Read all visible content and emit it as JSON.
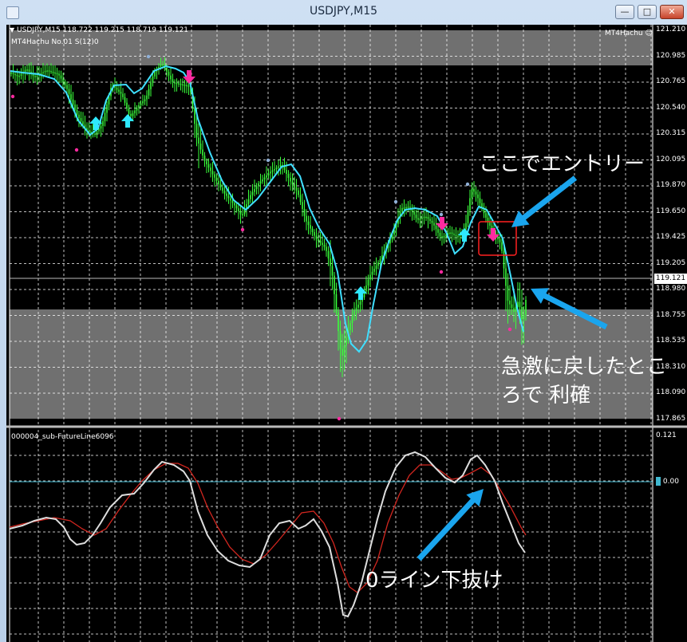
{
  "window": {
    "title": "USDJPY,M15"
  },
  "main_chart": {
    "info": "USDJPY,M15  118.722 119.215 118.719 119.121",
    "indicator": "MT4Hachu  No.01  S(12)0",
    "expert_label": "MT4Hachu",
    "price_ticks": [
      "121.210",
      "120.985",
      "120.765",
      "120.540",
      "120.315",
      "120.095",
      "119.870",
      "119.650",
      "119.425",
      "119.205",
      "118.980",
      "118.755",
      "118.535",
      "118.310",
      "118.090",
      "117.865"
    ],
    "current_price": "119.121",
    "annotation_entry": "ここでエントリー",
    "annotation_exit_line1": "急激に戻したとこ",
    "annotation_exit_line2": "ろで 利確"
  },
  "sub_chart": {
    "indicator": "000004_sub-FutureLine6096",
    "ticks": [
      "0.121"
    ],
    "zero_label": "0.00",
    "annotation": "0ライン下抜け"
  },
  "colors": {
    "candles": "#39ff3a",
    "ma": "#3fdfff",
    "up_arrow": "#2ee9ff",
    "down_arrow": "#ff2aa0",
    "signal_box": "#ff2020",
    "annotation_arrow": "#1aa5ee",
    "bands": "#707070",
    "sub_line_white": "#dddddd",
    "sub_line_red": "#d2261f",
    "zero_line": "#3fb7cf"
  }
}
